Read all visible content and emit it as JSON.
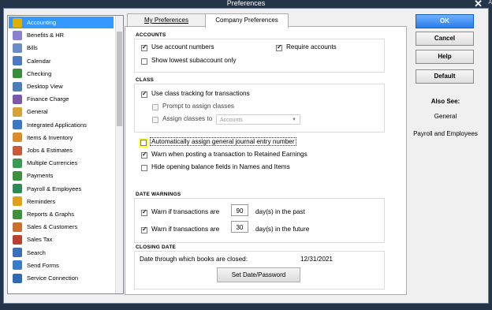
{
  "window": {
    "title": "Preferences",
    "extra_text": "A"
  },
  "sidebar": {
    "items": [
      {
        "label": "Accounting",
        "color": "#e0b000",
        "selected": true
      },
      {
        "label": "Benefits & HR",
        "color": "#8a7fd1"
      },
      {
        "label": "Bills",
        "color": "#6a8cc7"
      },
      {
        "label": "Calendar",
        "color": "#4f78c4"
      },
      {
        "label": "Checking",
        "color": "#3b8c3b"
      },
      {
        "label": "Desktop View",
        "color": "#4c7fb5"
      },
      {
        "label": "Finance Charge",
        "color": "#7a5aa8"
      },
      {
        "label": "General",
        "color": "#d6a23a"
      },
      {
        "label": "Integrated Applications",
        "color": "#3c79c2"
      },
      {
        "label": "Items & Inventory",
        "color": "#d98e2b"
      },
      {
        "label": "Jobs & Estimates",
        "color": "#c95a3a"
      },
      {
        "label": "Multiple Currencies",
        "color": "#3a9a55"
      },
      {
        "label": "Payments",
        "color": "#3e8f3e"
      },
      {
        "label": "Payroll & Employees",
        "color": "#2e8b57"
      },
      {
        "label": "Reminders",
        "color": "#e0a21a"
      },
      {
        "label": "Reports & Graphs",
        "color": "#3f8f3f"
      },
      {
        "label": "Sales & Customers",
        "color": "#c9702f"
      },
      {
        "label": "Sales Tax",
        "color": "#b8402f"
      },
      {
        "label": "Search",
        "color": "#3c6fb8"
      },
      {
        "label": "Send Forms",
        "color": "#3a7cc7"
      },
      {
        "label": "Service Connection",
        "color": "#2d6cb5"
      }
    ]
  },
  "tabs": {
    "my": "My Preferences",
    "company": "Company Preferences"
  },
  "accounts": {
    "title": "ACCOUNTS",
    "use_numbers": "Use account numbers",
    "require": "Require accounts",
    "show_lowest": "Show lowest subaccount only"
  },
  "class": {
    "title": "CLASS",
    "use_tracking": "Use class tracking for transactions",
    "prompt": "Prompt to assign classes",
    "assign_to": "Assign classes to",
    "dropdown_value": "Accounts"
  },
  "misc": {
    "auto_assign": "Automatically assign general journal entry number",
    "warn_retained": "Warn when posting a transaction to Retained Earnings",
    "hide_opening": "Hide opening balance fields in Names and Items"
  },
  "date_warnings": {
    "title": "DATE WARNINGS",
    "past_label": "Warn if transactions are",
    "past_days": "90",
    "past_suffix": "day(s) in the past",
    "future_label": "Warn if transactions are",
    "future_days": "30",
    "future_suffix": "day(s) in the future"
  },
  "closing": {
    "title": "CLOSING DATE",
    "label": "Date through which books are closed:",
    "date": "12/31/2021",
    "button": "Set Date/Password"
  },
  "buttons": {
    "ok": "OK",
    "cancel": "Cancel",
    "help": "Help",
    "default": "Default"
  },
  "also_see": {
    "title": "Also See:",
    "links": [
      "General",
      "Payroll and Employees"
    ]
  },
  "colors": {
    "accent": "#3399ff",
    "highlight": "#ffff44",
    "ok_button": "#2b7de9"
  }
}
